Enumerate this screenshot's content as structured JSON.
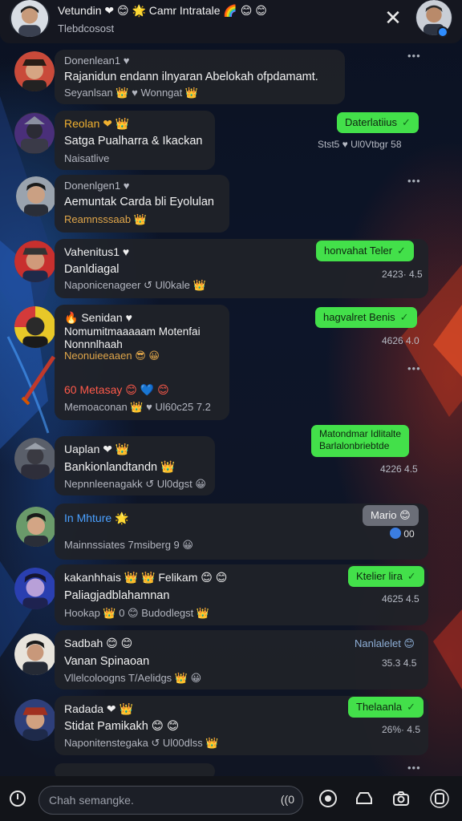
{
  "header": {
    "title": "Vetundin ❤ 😊 🌟 Camr Intratale 🌈 😊 😊",
    "subtitle": "Tlebdcosost"
  },
  "messages": [
    {
      "name": "Donenlean1 ♥",
      "text": "Rajanidun endann ilnyaran Abelokah ofpdamamt.",
      "meta": "Seyanlsan 👑 ♥ Wonngat 👑"
    },
    {
      "name": "Reolan ❤ 👑",
      "text": "Satga Pualharra & Ikackan",
      "meta": "Naisatlive"
    },
    {
      "name": "Donenlgen1 ♥",
      "text": "Aemuntak Carda bli Eyolulan",
      "meta": "Reamnsssaab 👑"
    },
    {
      "name": "Vahenitus1 ♥",
      "text": "Danldiagal",
      "meta": "Naponicenageer ↺ Ul0kale 👑"
    },
    {
      "name": "🔥 Senidan ♥",
      "text": "Nomumitmaaaaam Motenfai",
      "text2": "Nonnnlhaah",
      "meta": "Neonuieeaaen 😎 😀"
    },
    {
      "name": "60 Metasay 😊 💙 😊",
      "meta": "Memoaconan 👑 ♥ Ul60c25 7.2"
    },
    {
      "name": "Uaplan ❤ 👑",
      "text": "Bankionlandtandn 👑",
      "meta": "Nepnnleenagakk ↺ Ul0dgst 😀"
    },
    {
      "name": "In Mhture 🌟",
      "meta": "Mainnssiates  7msiberg 9 😀"
    },
    {
      "name": "kakanhhais 👑 👑 Felikam 😊 😊",
      "text": "Paliagjadblahamnan",
      "meta": "Hookap 👑 0 😊 Budodlegst 👑"
    },
    {
      "name": "Sadbah 😊 😊",
      "text": "Vanan Spinaoan",
      "meta": "Vllelcoloogns T/Aelidgs 👑 😀"
    },
    {
      "name": "Radada ❤ 👑",
      "text": "Stidat Pamikakh 😊 😊",
      "meta": "Naponitenstegaka ↺ Ul00dlss 👑"
    }
  ],
  "replies": [
    {
      "text": "Daterlatiius",
      "meta": "Stst5 ♥ Ul0Vtbgr 58"
    },
    {
      "text": "honvahat Teler",
      "meta": "2423· 4.5"
    },
    {
      "text": "hagvalret Benis",
      "meta": "4626 4.0"
    },
    {
      "text": "Matondmar Idlitalte",
      "text2": "Barlalonbriebtde",
      "meta": "4226 4.5"
    },
    {
      "text": "Mario 😊",
      "meta": "00"
    },
    {
      "text": "Ktelier lira",
      "meta": "4625 4.5"
    },
    {
      "text": "Nanlalelet 😊",
      "meta": "35.3 4.5"
    },
    {
      "text": "Thelaanla",
      "meta": "26%· 4.5"
    }
  ],
  "input": {
    "placeholder": "Chah semangke."
  },
  "icons": {
    "close": "close-icon",
    "mic": "mic-icon",
    "emoji": "emoji-icon",
    "car": "car-icon",
    "camera": "camera-icon",
    "square": "square-icon"
  },
  "colors": {
    "accent_green": "#43e04a",
    "bubble": "#202228",
    "header": "#16181f"
  }
}
